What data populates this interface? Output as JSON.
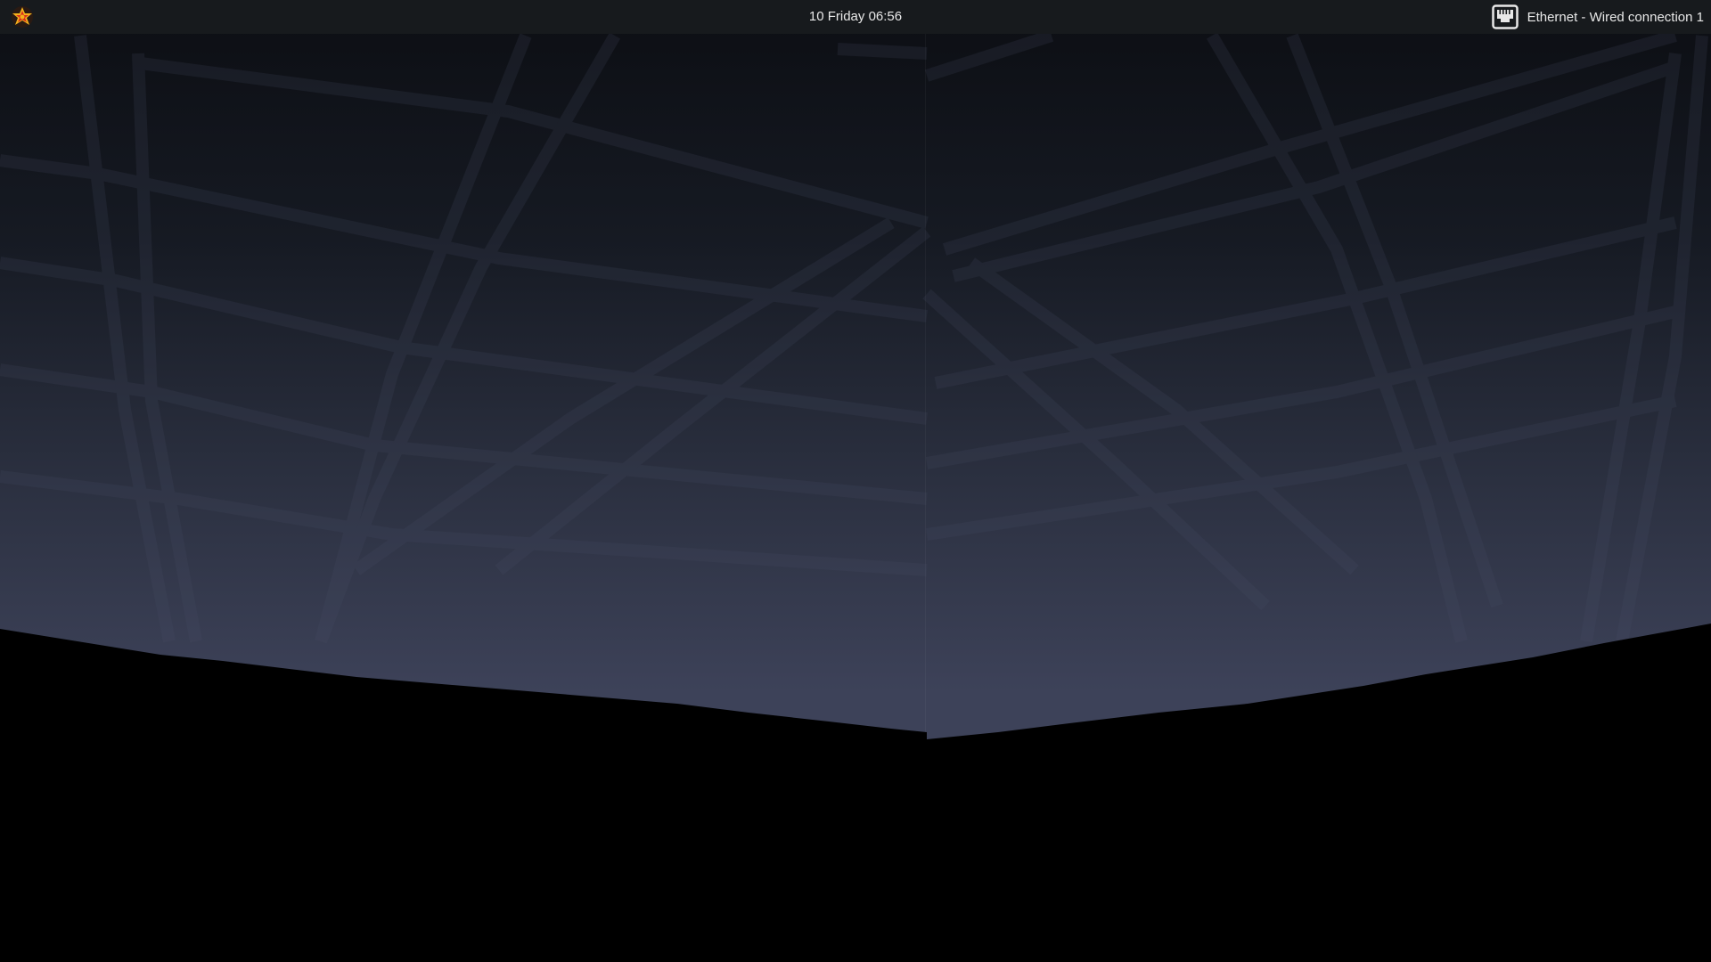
{
  "topbar": {
    "menu_icon": "desktop-menu-logo-icon",
    "clock_text": "10 Friday 06:56",
    "network": {
      "icon": "ethernet-icon",
      "label": "Ethernet - Wired connection 1"
    }
  },
  "colors": {
    "topbar_bg": "#171a1d",
    "sky_top": "#0d0f14",
    "sky_bottom": "#3b4058",
    "horizon": "#000000",
    "logo_red": "#d72d1c",
    "logo_yellow": "#f3b21c"
  }
}
